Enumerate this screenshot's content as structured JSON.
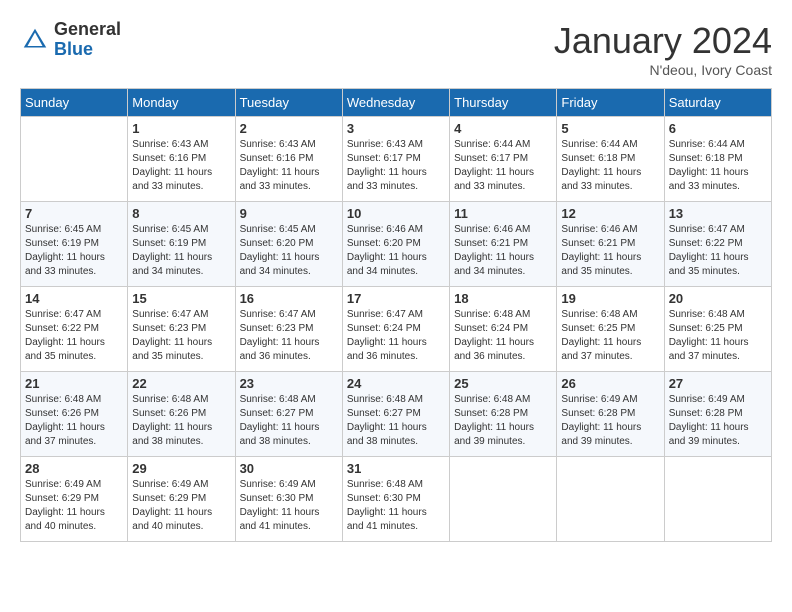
{
  "header": {
    "logo_general": "General",
    "logo_blue": "Blue",
    "month_title": "January 2024",
    "subtitle": "N'deou, Ivory Coast"
  },
  "days_of_week": [
    "Sunday",
    "Monday",
    "Tuesday",
    "Wednesday",
    "Thursday",
    "Friday",
    "Saturday"
  ],
  "weeks": [
    [
      {
        "day": "",
        "sunrise": "",
        "sunset": "",
        "daylight": ""
      },
      {
        "day": "1",
        "sunrise": "6:43 AM",
        "sunset": "6:16 PM",
        "daylight": "11 hours and 33 minutes."
      },
      {
        "day": "2",
        "sunrise": "6:43 AM",
        "sunset": "6:16 PM",
        "daylight": "11 hours and 33 minutes."
      },
      {
        "day": "3",
        "sunrise": "6:43 AM",
        "sunset": "6:17 PM",
        "daylight": "11 hours and 33 minutes."
      },
      {
        "day": "4",
        "sunrise": "6:44 AM",
        "sunset": "6:17 PM",
        "daylight": "11 hours and 33 minutes."
      },
      {
        "day": "5",
        "sunrise": "6:44 AM",
        "sunset": "6:18 PM",
        "daylight": "11 hours and 33 minutes."
      },
      {
        "day": "6",
        "sunrise": "6:44 AM",
        "sunset": "6:18 PM",
        "daylight": "11 hours and 33 minutes."
      }
    ],
    [
      {
        "day": "7",
        "sunrise": "6:45 AM",
        "sunset": "6:19 PM",
        "daylight": "11 hours and 33 minutes."
      },
      {
        "day": "8",
        "sunrise": "6:45 AM",
        "sunset": "6:19 PM",
        "daylight": "11 hours and 34 minutes."
      },
      {
        "day": "9",
        "sunrise": "6:45 AM",
        "sunset": "6:20 PM",
        "daylight": "11 hours and 34 minutes."
      },
      {
        "day": "10",
        "sunrise": "6:46 AM",
        "sunset": "6:20 PM",
        "daylight": "11 hours and 34 minutes."
      },
      {
        "day": "11",
        "sunrise": "6:46 AM",
        "sunset": "6:21 PM",
        "daylight": "11 hours and 34 minutes."
      },
      {
        "day": "12",
        "sunrise": "6:46 AM",
        "sunset": "6:21 PM",
        "daylight": "11 hours and 35 minutes."
      },
      {
        "day": "13",
        "sunrise": "6:47 AM",
        "sunset": "6:22 PM",
        "daylight": "11 hours and 35 minutes."
      }
    ],
    [
      {
        "day": "14",
        "sunrise": "6:47 AM",
        "sunset": "6:22 PM",
        "daylight": "11 hours and 35 minutes."
      },
      {
        "day": "15",
        "sunrise": "6:47 AM",
        "sunset": "6:23 PM",
        "daylight": "11 hours and 35 minutes."
      },
      {
        "day": "16",
        "sunrise": "6:47 AM",
        "sunset": "6:23 PM",
        "daylight": "11 hours and 36 minutes."
      },
      {
        "day": "17",
        "sunrise": "6:47 AM",
        "sunset": "6:24 PM",
        "daylight": "11 hours and 36 minutes."
      },
      {
        "day": "18",
        "sunrise": "6:48 AM",
        "sunset": "6:24 PM",
        "daylight": "11 hours and 36 minutes."
      },
      {
        "day": "19",
        "sunrise": "6:48 AM",
        "sunset": "6:25 PM",
        "daylight": "11 hours and 37 minutes."
      },
      {
        "day": "20",
        "sunrise": "6:48 AM",
        "sunset": "6:25 PM",
        "daylight": "11 hours and 37 minutes."
      }
    ],
    [
      {
        "day": "21",
        "sunrise": "6:48 AM",
        "sunset": "6:26 PM",
        "daylight": "11 hours and 37 minutes."
      },
      {
        "day": "22",
        "sunrise": "6:48 AM",
        "sunset": "6:26 PM",
        "daylight": "11 hours and 38 minutes."
      },
      {
        "day": "23",
        "sunrise": "6:48 AM",
        "sunset": "6:27 PM",
        "daylight": "11 hours and 38 minutes."
      },
      {
        "day": "24",
        "sunrise": "6:48 AM",
        "sunset": "6:27 PM",
        "daylight": "11 hours and 38 minutes."
      },
      {
        "day": "25",
        "sunrise": "6:48 AM",
        "sunset": "6:28 PM",
        "daylight": "11 hours and 39 minutes."
      },
      {
        "day": "26",
        "sunrise": "6:49 AM",
        "sunset": "6:28 PM",
        "daylight": "11 hours and 39 minutes."
      },
      {
        "day": "27",
        "sunrise": "6:49 AM",
        "sunset": "6:28 PM",
        "daylight": "11 hours and 39 minutes."
      }
    ],
    [
      {
        "day": "28",
        "sunrise": "6:49 AM",
        "sunset": "6:29 PM",
        "daylight": "11 hours and 40 minutes."
      },
      {
        "day": "29",
        "sunrise": "6:49 AM",
        "sunset": "6:29 PM",
        "daylight": "11 hours and 40 minutes."
      },
      {
        "day": "30",
        "sunrise": "6:49 AM",
        "sunset": "6:30 PM",
        "daylight": "11 hours and 41 minutes."
      },
      {
        "day": "31",
        "sunrise": "6:48 AM",
        "sunset": "6:30 PM",
        "daylight": "11 hours and 41 minutes."
      },
      {
        "day": "",
        "sunrise": "",
        "sunset": "",
        "daylight": ""
      },
      {
        "day": "",
        "sunrise": "",
        "sunset": "",
        "daylight": ""
      },
      {
        "day": "",
        "sunrise": "",
        "sunset": "",
        "daylight": ""
      }
    ]
  ],
  "labels": {
    "sunrise_prefix": "Sunrise: ",
    "sunset_prefix": "Sunset: ",
    "daylight_prefix": "Daylight: "
  }
}
